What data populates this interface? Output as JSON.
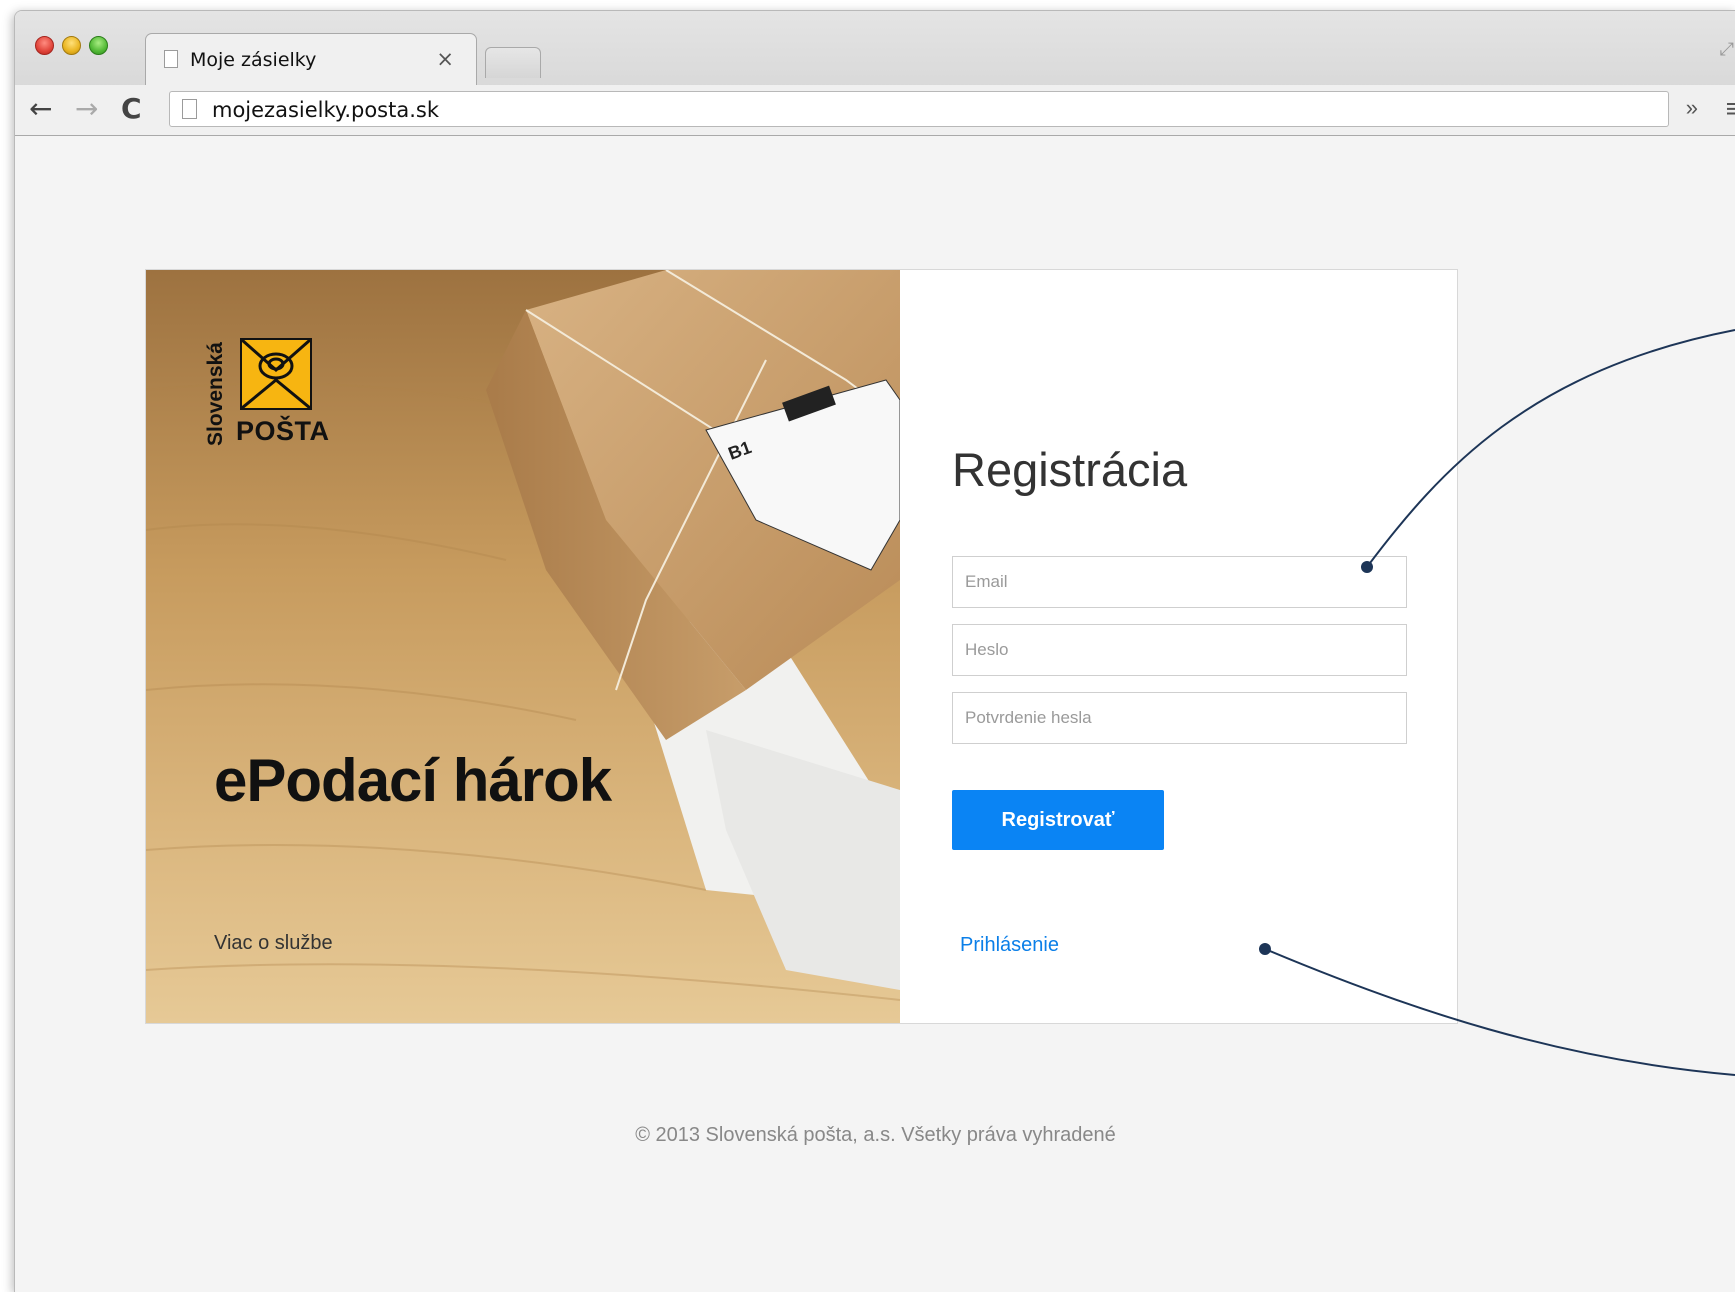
{
  "browser": {
    "tab_title": "Moje zásielky",
    "tab_close": "×",
    "url": "mojezasielky.posta.sk",
    "nav_back": "←",
    "nav_forward": "→",
    "nav_reload": "C",
    "chevron": "»",
    "menu": "≡"
  },
  "logo": {
    "vertical_word": "Slovenská",
    "horizontal_word": "POŠTA",
    "brand_color": "#f7b511"
  },
  "hero": {
    "title": "ePodací hárok",
    "more_link": "Viac o službe"
  },
  "form": {
    "title": "Registrácia",
    "email_placeholder": "Email",
    "password_placeholder": "Heslo",
    "confirm_placeholder": "Potvrdenie hesla",
    "submit_label": "Registrovať",
    "login_link": "Prihlásenie",
    "accent_color": "#0a84f4"
  },
  "footer": {
    "copyright": "© 2013 Slovenská pošta, a.s. Všetky práva vyhradené"
  }
}
